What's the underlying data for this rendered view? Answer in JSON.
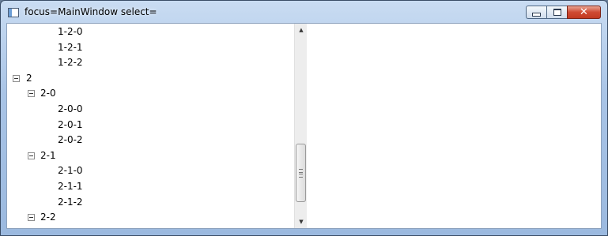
{
  "window": {
    "title": "focus=MainWindow select="
  },
  "caption_buttons": {
    "close_glyph": "✕"
  },
  "tree": {
    "rows": [
      {
        "label": "1-2-0",
        "level": 2,
        "expander": false
      },
      {
        "label": "1-2-1",
        "level": 2,
        "expander": false
      },
      {
        "label": "1-2-2",
        "level": 2,
        "expander": false
      },
      {
        "label": "2",
        "level": 0,
        "expander": true
      },
      {
        "label": "2-0",
        "level": 1,
        "expander": true
      },
      {
        "label": "2-0-0",
        "level": 2,
        "expander": false
      },
      {
        "label": "2-0-1",
        "level": 2,
        "expander": false
      },
      {
        "label": "2-0-2",
        "level": 2,
        "expander": false
      },
      {
        "label": "2-1",
        "level": 1,
        "expander": true
      },
      {
        "label": "2-1-0",
        "level": 2,
        "expander": false
      },
      {
        "label": "2-1-1",
        "level": 2,
        "expander": false
      },
      {
        "label": "2-1-2",
        "level": 2,
        "expander": false
      },
      {
        "label": "2-2",
        "level": 1,
        "expander": true
      }
    ]
  },
  "scrollbar": {
    "up_glyph": "▲",
    "down_glyph": "▼"
  }
}
